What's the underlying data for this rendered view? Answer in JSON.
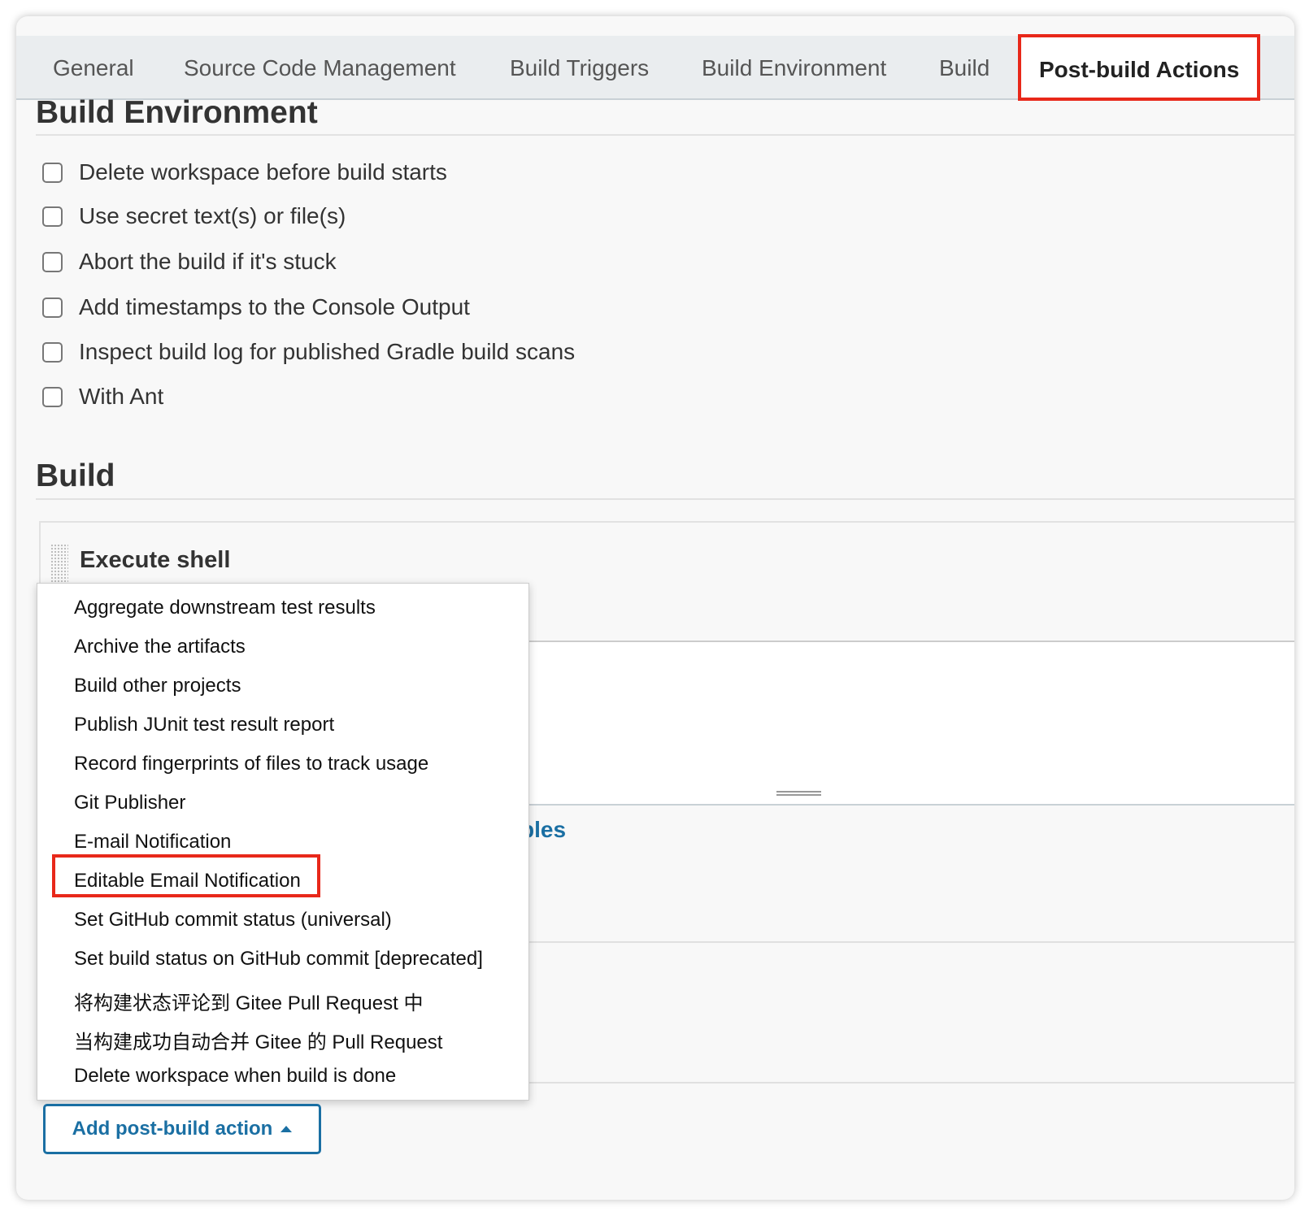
{
  "tabs": [
    "General",
    "Source Code Management",
    "Build Triggers",
    "Build Environment",
    "Build",
    "Post-build Actions"
  ],
  "active_tab": "Post-build Actions",
  "build_environment": {
    "title": "Build Environment",
    "options": [
      "Delete workspace before build starts",
      "Use secret text(s) or file(s)",
      "Abort the build if it's stuck",
      "Add timestamps to the Console Output",
      "Inspect build log for published Gradle build scans",
      "With Ant"
    ]
  },
  "build": {
    "title": "Build",
    "step_title": "Execute shell",
    "partial_link": "bles"
  },
  "menu": {
    "items": [
      "Aggregate downstream test results",
      "Archive the artifacts",
      "Build other projects",
      "Publish JUnit test result report",
      "Record fingerprints of files to track usage",
      "Git Publisher",
      "E-mail Notification",
      "Editable Email Notification",
      "Set GitHub commit status (universal)",
      "Set build status on GitHub commit [deprecated]",
      "将构建状态评论到 Gitee Pull Request 中",
      "当构建成功自动合并 Gitee 的 Pull Request",
      "Delete workspace when build is done"
    ],
    "highlighted": "Editable Email Notification"
  },
  "add_button": "Add post-build action",
  "colors": {
    "highlight": "#e8281a",
    "link": "#1a6fa3"
  }
}
